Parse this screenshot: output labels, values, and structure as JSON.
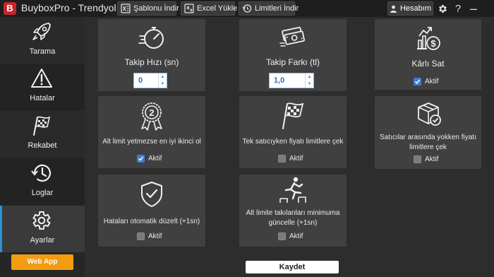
{
  "app": {
    "logo_letter": "B",
    "title": "BuyboxPro - Trendyol"
  },
  "toolbar": {
    "template_download": "Şablonu İndir",
    "excel_upload": "Excel Yükle",
    "limits_download": "Limitleri İndir",
    "account": "Hesabım"
  },
  "sidebar": {
    "items": [
      {
        "label": "Tarama",
        "icon": "rocket-icon"
      },
      {
        "label": "Hatalar",
        "icon": "warning-icon"
      },
      {
        "label": "Rekabet",
        "icon": "race-flag-icon"
      },
      {
        "label": "Loglar",
        "icon": "history-icon"
      },
      {
        "label": "Ayarlar",
        "icon": "gear-icon"
      }
    ],
    "active": "Ayarlar",
    "web_app": "Web App"
  },
  "cards": {
    "speed": {
      "title": "Takip Hızı (sn)",
      "value": "0"
    },
    "price_diff": {
      "title": "Takip Farkı (tl)",
      "value": "1,0"
    },
    "profitable": {
      "title": "Kârlı Sat",
      "active_label": "Aktif",
      "checked": true
    },
    "second_best": {
      "desc": "Alt limit yetmezse en iyi ikinci ol",
      "active_label": "Aktif",
      "checked": true
    },
    "sole_seller": {
      "desc": "Tek satıcıyken fiyatı limitlere çek",
      "active_label": "Aktif",
      "checked": false
    },
    "between_sellers": {
      "desc": "Satıcılar arasında yokken fiyatı limitlere çek",
      "active_label": "Aktif",
      "checked": false
    },
    "auto_fix": {
      "desc": "Hataları otomatik düzelt (+1sn)",
      "active_label": "Aktif",
      "checked": false
    },
    "min_update": {
      "desc": "Alt limite takılanları minimuma güncelle (+1sn)",
      "active_label": "Aktif",
      "checked": false
    }
  },
  "save": "Kaydet",
  "colors": {
    "accent": "#2d8fd8",
    "brand_red": "#c8262c",
    "web_app_orange": "#f39c12",
    "checkbox_blue": "#3b7fd4"
  }
}
